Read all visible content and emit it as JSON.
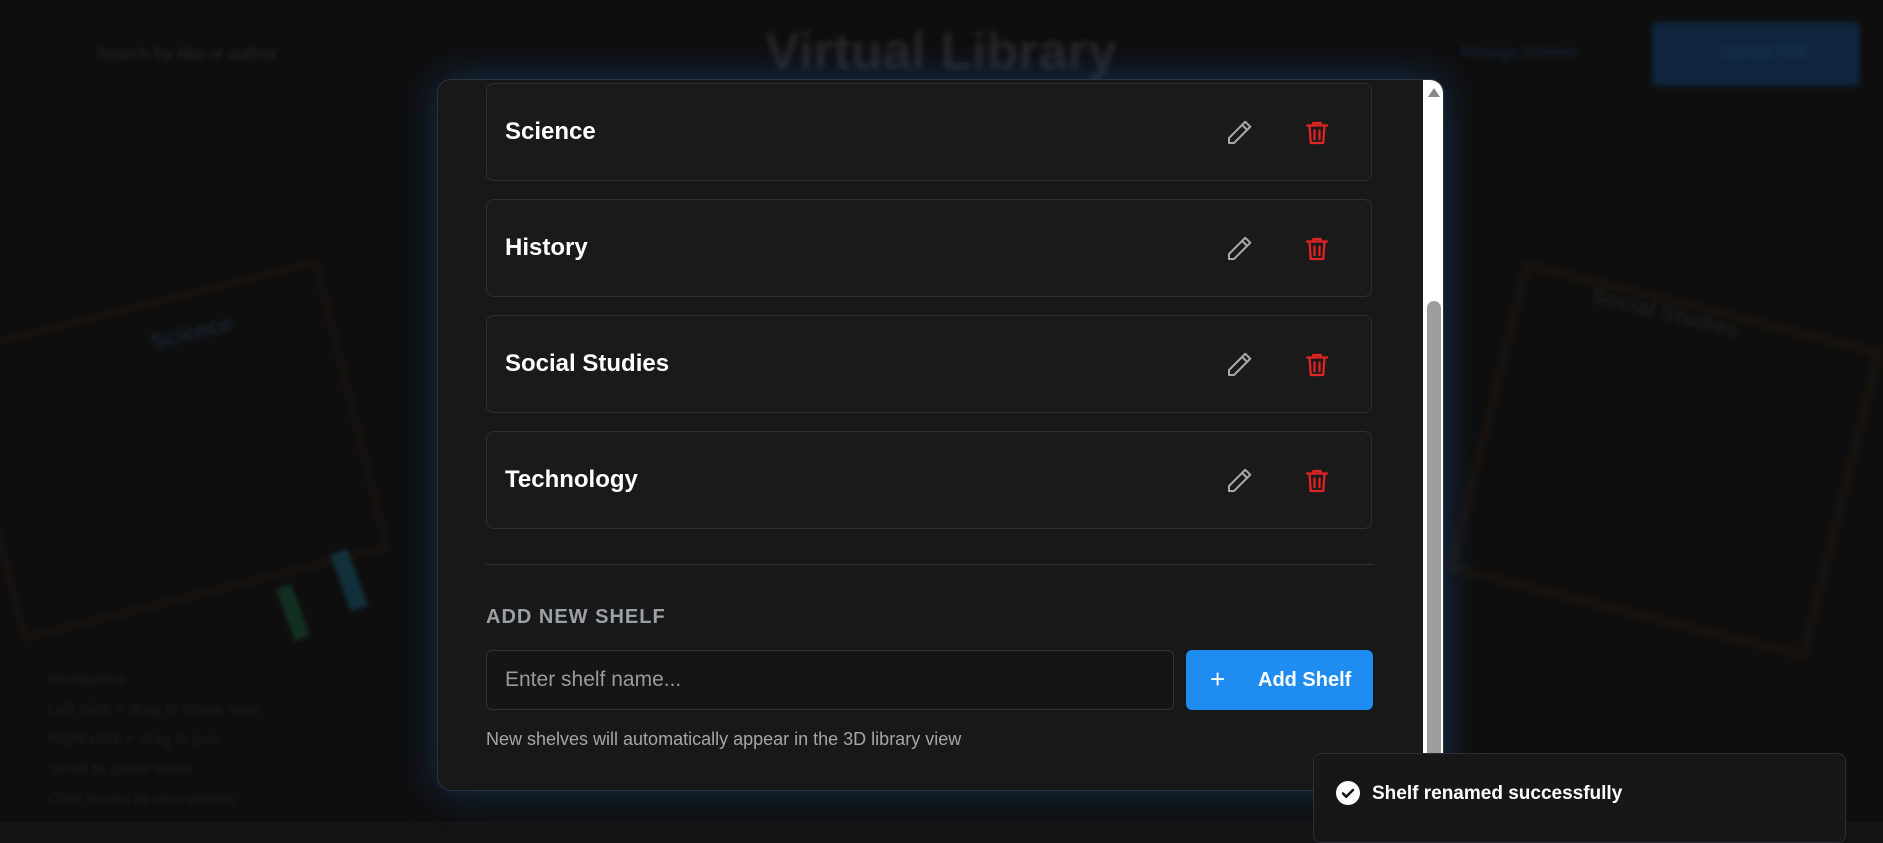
{
  "background": {
    "search_placeholder": "Search by title or author",
    "title": "Virtual Library",
    "manage_label": "Manage Shelves",
    "upload_label": "Upload PDF",
    "left_shelf_label": "Science",
    "right_shelf_label": "Social Studies",
    "nav_title": "Navigation",
    "nav_lines": [
      "Left click + drag to rotate view",
      "Right click + drag to pan",
      "Scroll to zoom in/out",
      "Click books to view details"
    ]
  },
  "modal": {
    "shelves": [
      {
        "name": "Science"
      },
      {
        "name": "History"
      },
      {
        "name": "Social Studies"
      },
      {
        "name": "Technology"
      }
    ],
    "add_section_title": "ADD NEW SHELF",
    "input_placeholder": "Enter shelf name...",
    "add_button_label": "Add Shelf",
    "add_button_icon": "+",
    "hint_text": "New shelves will automatically appear in the 3D library view"
  },
  "toast": {
    "message": "Shelf renamed successfully",
    "icon": "check-circle-icon"
  },
  "colors": {
    "accent": "#1e8cf0",
    "danger": "#e02424",
    "icon_gray": "#a8a8a8"
  }
}
